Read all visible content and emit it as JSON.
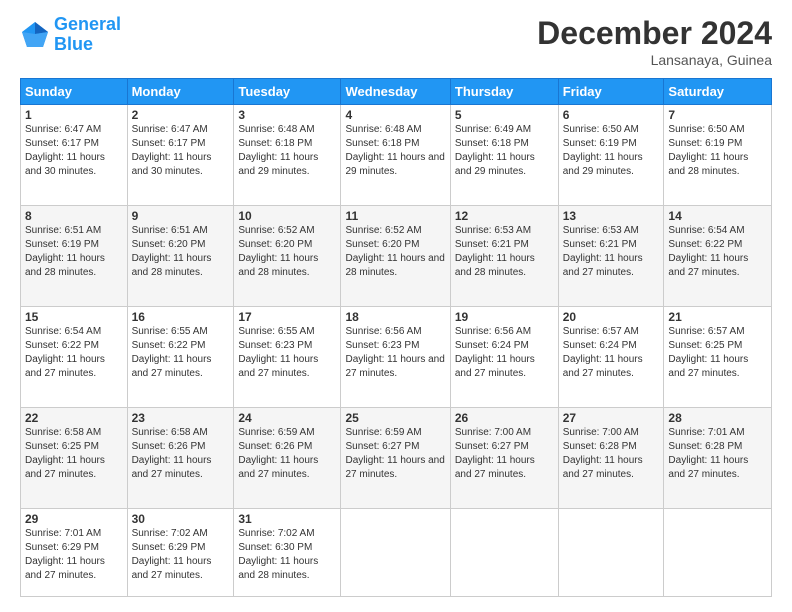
{
  "header": {
    "logo_line1": "General",
    "logo_line2": "Blue",
    "month": "December 2024",
    "location": "Lansanaya, Guinea"
  },
  "weekdays": [
    "Sunday",
    "Monday",
    "Tuesday",
    "Wednesday",
    "Thursday",
    "Friday",
    "Saturday"
  ],
  "weeks": [
    [
      {
        "day": "1",
        "sunrise": "6:47 AM",
        "sunset": "6:17 PM",
        "daylight": "11 hours and 30 minutes."
      },
      {
        "day": "2",
        "sunrise": "6:47 AM",
        "sunset": "6:17 PM",
        "daylight": "11 hours and 30 minutes."
      },
      {
        "day": "3",
        "sunrise": "6:48 AM",
        "sunset": "6:18 PM",
        "daylight": "11 hours and 29 minutes."
      },
      {
        "day": "4",
        "sunrise": "6:48 AM",
        "sunset": "6:18 PM",
        "daylight": "11 hours and 29 minutes."
      },
      {
        "day": "5",
        "sunrise": "6:49 AM",
        "sunset": "6:18 PM",
        "daylight": "11 hours and 29 minutes."
      },
      {
        "day": "6",
        "sunrise": "6:50 AM",
        "sunset": "6:19 PM",
        "daylight": "11 hours and 29 minutes."
      },
      {
        "day": "7",
        "sunrise": "6:50 AM",
        "sunset": "6:19 PM",
        "daylight": "11 hours and 28 minutes."
      }
    ],
    [
      {
        "day": "8",
        "sunrise": "6:51 AM",
        "sunset": "6:19 PM",
        "daylight": "11 hours and 28 minutes."
      },
      {
        "day": "9",
        "sunrise": "6:51 AM",
        "sunset": "6:20 PM",
        "daylight": "11 hours and 28 minutes."
      },
      {
        "day": "10",
        "sunrise": "6:52 AM",
        "sunset": "6:20 PM",
        "daylight": "11 hours and 28 minutes."
      },
      {
        "day": "11",
        "sunrise": "6:52 AM",
        "sunset": "6:20 PM",
        "daylight": "11 hours and 28 minutes."
      },
      {
        "day": "12",
        "sunrise": "6:53 AM",
        "sunset": "6:21 PM",
        "daylight": "11 hours and 28 minutes."
      },
      {
        "day": "13",
        "sunrise": "6:53 AM",
        "sunset": "6:21 PM",
        "daylight": "11 hours and 27 minutes."
      },
      {
        "day": "14",
        "sunrise": "6:54 AM",
        "sunset": "6:22 PM",
        "daylight": "11 hours and 27 minutes."
      }
    ],
    [
      {
        "day": "15",
        "sunrise": "6:54 AM",
        "sunset": "6:22 PM",
        "daylight": "11 hours and 27 minutes."
      },
      {
        "day": "16",
        "sunrise": "6:55 AM",
        "sunset": "6:22 PM",
        "daylight": "11 hours and 27 minutes."
      },
      {
        "day": "17",
        "sunrise": "6:55 AM",
        "sunset": "6:23 PM",
        "daylight": "11 hours and 27 minutes."
      },
      {
        "day": "18",
        "sunrise": "6:56 AM",
        "sunset": "6:23 PM",
        "daylight": "11 hours and 27 minutes."
      },
      {
        "day": "19",
        "sunrise": "6:56 AM",
        "sunset": "6:24 PM",
        "daylight": "11 hours and 27 minutes."
      },
      {
        "day": "20",
        "sunrise": "6:57 AM",
        "sunset": "6:24 PM",
        "daylight": "11 hours and 27 minutes."
      },
      {
        "day": "21",
        "sunrise": "6:57 AM",
        "sunset": "6:25 PM",
        "daylight": "11 hours and 27 minutes."
      }
    ],
    [
      {
        "day": "22",
        "sunrise": "6:58 AM",
        "sunset": "6:25 PM",
        "daylight": "11 hours and 27 minutes."
      },
      {
        "day": "23",
        "sunrise": "6:58 AM",
        "sunset": "6:26 PM",
        "daylight": "11 hours and 27 minutes."
      },
      {
        "day": "24",
        "sunrise": "6:59 AM",
        "sunset": "6:26 PM",
        "daylight": "11 hours and 27 minutes."
      },
      {
        "day": "25",
        "sunrise": "6:59 AM",
        "sunset": "6:27 PM",
        "daylight": "11 hours and 27 minutes."
      },
      {
        "day": "26",
        "sunrise": "7:00 AM",
        "sunset": "6:27 PM",
        "daylight": "11 hours and 27 minutes."
      },
      {
        "day": "27",
        "sunrise": "7:00 AM",
        "sunset": "6:28 PM",
        "daylight": "11 hours and 27 minutes."
      },
      {
        "day": "28",
        "sunrise": "7:01 AM",
        "sunset": "6:28 PM",
        "daylight": "11 hours and 27 minutes."
      }
    ],
    [
      {
        "day": "29",
        "sunrise": "7:01 AM",
        "sunset": "6:29 PM",
        "daylight": "11 hours and 27 minutes."
      },
      {
        "day": "30",
        "sunrise": "7:02 AM",
        "sunset": "6:29 PM",
        "daylight": "11 hours and 27 minutes."
      },
      {
        "day": "31",
        "sunrise": "7:02 AM",
        "sunset": "6:30 PM",
        "daylight": "11 hours and 28 minutes."
      },
      null,
      null,
      null,
      null
    ]
  ]
}
